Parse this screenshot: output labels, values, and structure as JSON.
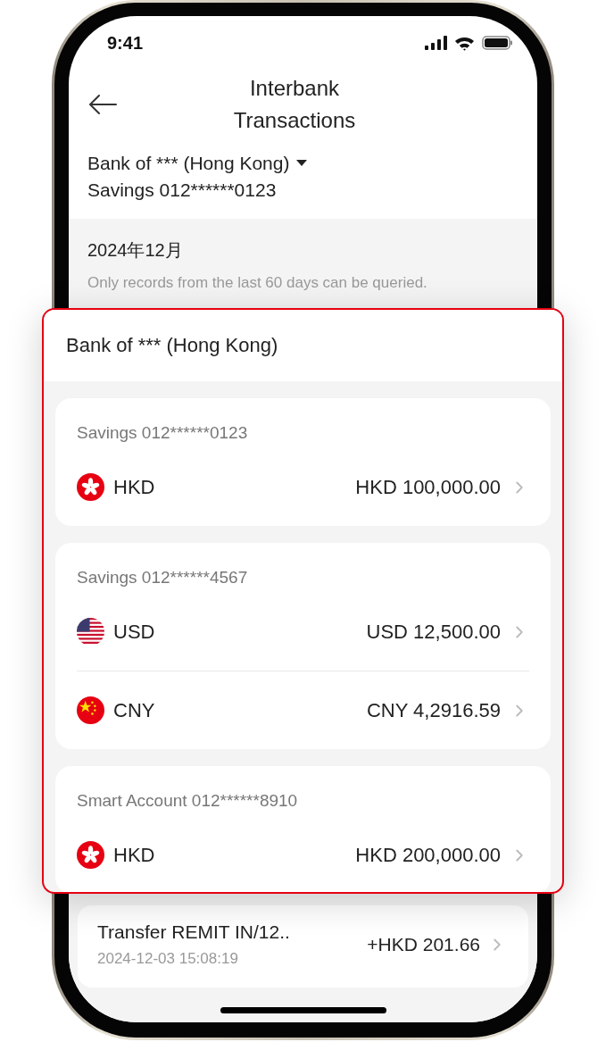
{
  "status_bar": {
    "time": "9:41"
  },
  "header": {
    "title": "Interbank Transactions"
  },
  "account_selector": {
    "bank": "Bank of *** (Hong Kong)",
    "account": "Savings 012******0123"
  },
  "month": "2024年12月",
  "note": "Only records from the last 60 days can be queried.",
  "transactions": [
    {
      "title": "Transfer REMIT IN/12..",
      "time": "2024-12-03 15:08:19",
      "amount": "+HKD 201.66"
    }
  ],
  "account_picker": {
    "title": "Bank of *** (Hong Kong)",
    "accounts": [
      {
        "name": "Savings 012******0123",
        "balances": [
          {
            "kind": "hk",
            "currency": "HKD",
            "amount": "HKD 100,000.00"
          }
        ]
      },
      {
        "name": "Savings 012******4567",
        "balances": [
          {
            "kind": "us",
            "currency": "USD",
            "amount": "USD 12,500.00"
          },
          {
            "kind": "cn",
            "currency": "CNY",
            "amount": "CNY 4,2916.59"
          }
        ]
      },
      {
        "name": "Smart Account 012******8910",
        "balances": [
          {
            "kind": "hk",
            "currency": "HKD",
            "amount": "HKD 200,000.00"
          }
        ]
      }
    ]
  }
}
